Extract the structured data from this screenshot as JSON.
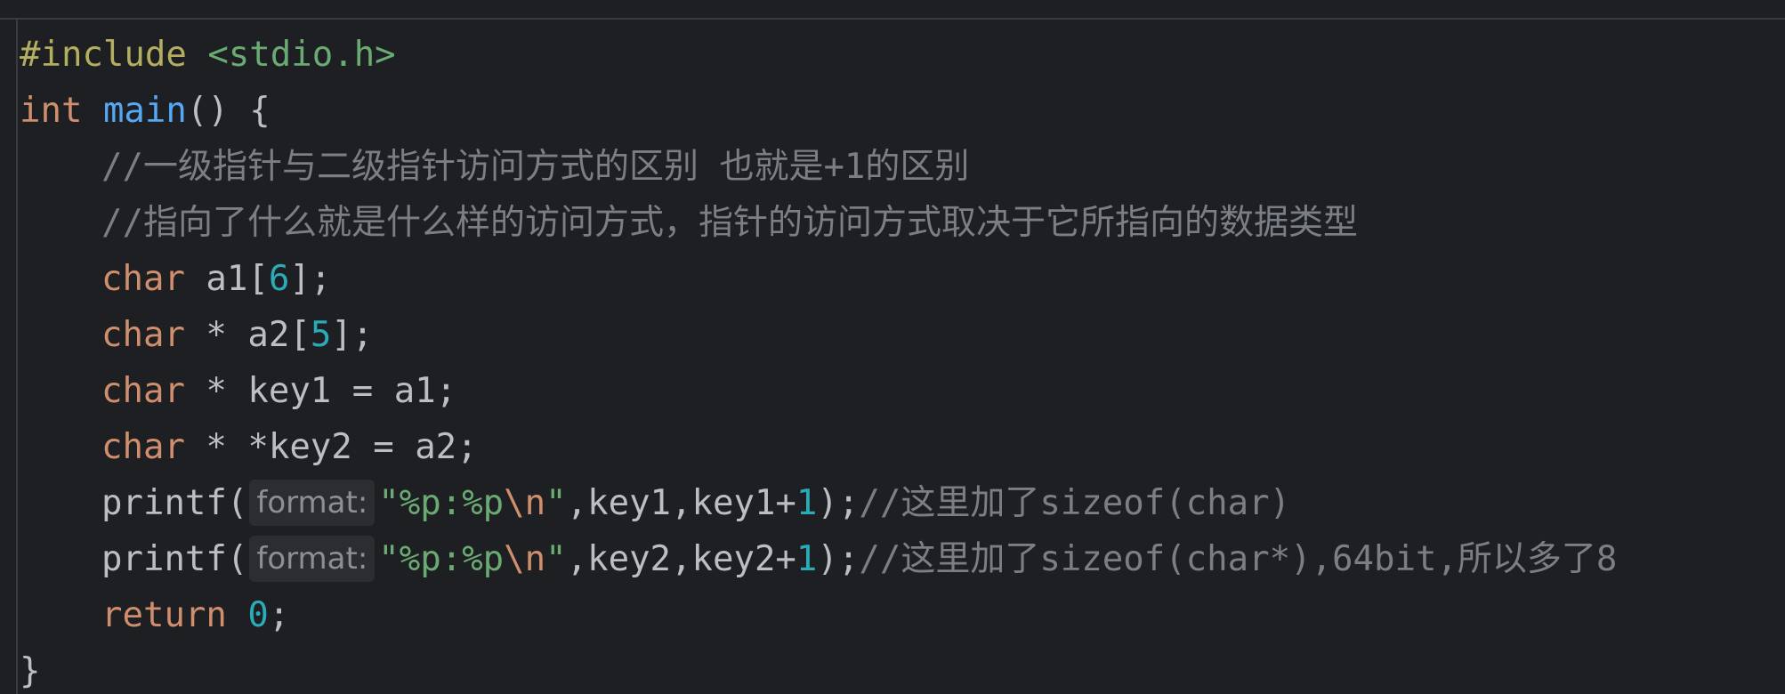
{
  "lines": {
    "l1": {
      "directive": "#include",
      "sep": " ",
      "header": "<stdio.h>"
    },
    "l2": {
      "type": "int",
      "sep": " ",
      "name": "main",
      "rest": "() {"
    },
    "l3": {
      "comment": "//一级指针与二级指针访问方式的区别 也就是+1的区别"
    },
    "l4": {
      "comment": "//指向了什么就是什么样的访问方式，指针的访问方式取决于它所指向的数据类型"
    },
    "l5": {
      "type": "char",
      "a": " a1[",
      "num": "6",
      "b": "];"
    },
    "l6": {
      "type": "char",
      "a": " * a2[",
      "num": "5",
      "b": "];"
    },
    "l7": {
      "type": "char",
      "a": " * key1 = a1;"
    },
    "l8": {
      "type": "char",
      "a": " * *key2 = a2;"
    },
    "l9": {
      "call": "printf(",
      "hint": "format:",
      "s1": "\"%p:%p",
      "esc": "\\n",
      "s2": "\"",
      "args": ",key1,key1+",
      "num": "1",
      "end": ");",
      "comment": "//这里加了sizeof(char)"
    },
    "l10": {
      "call": "printf(",
      "hint": "format:",
      "s1": "\"%p:%p",
      "esc": "\\n",
      "s2": "\"",
      "args": ",key2,key2+",
      "num": "1",
      "end": ");",
      "comment": "//这里加了sizeof(char*),64bit,所以多了8"
    },
    "l11": {
      "kw": "return",
      "sep": " ",
      "num": "0",
      "end": ";"
    },
    "l12": {
      "brace": "}"
    }
  },
  "colors": {
    "background": "#1e1f22",
    "keyword": "#cf8e6d",
    "function": "#56a8f5",
    "number": "#2aacb8",
    "string": "#6aab73",
    "comment": "#7a7e85",
    "preprocessor": "#b3ae60",
    "text": "#bcbec4",
    "inlay_hint_bg": "#2b2d30"
  }
}
